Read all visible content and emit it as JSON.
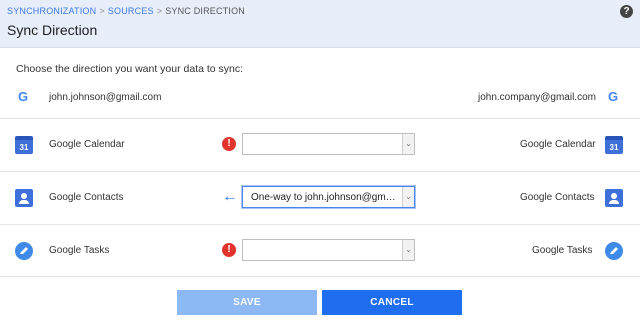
{
  "breadcrumb": {
    "items": [
      "SYNCHRONIZATION",
      "SOURCES"
    ],
    "separator": ">",
    "current": "SYNC DIRECTION"
  },
  "page_title": "Sync Direction",
  "help_icon": "?",
  "instruction": "Choose the direction you want your data to sync:",
  "accounts": {
    "left": "john.johnson@gmail.com",
    "right": "john.company@gmail.com",
    "logo_letter": "G"
  },
  "services": [
    {
      "name": "Google Calendar",
      "icon": "calendar-icon",
      "icon_text": "31",
      "indicator": "!",
      "indicator_type": "warning",
      "selected": ""
    },
    {
      "name": "Google Contacts",
      "icon": "contacts-icon",
      "icon_text": "",
      "indicator": "←",
      "indicator_type": "direction",
      "selected": "One-way to john.johnson@gmail.com"
    },
    {
      "name": "Google Tasks",
      "icon": "tasks-icon",
      "icon_text": "",
      "indicator": "!",
      "indicator_type": "warning",
      "selected": ""
    }
  ],
  "caret": "⌄",
  "buttons": {
    "save": "SAVE",
    "cancel": "CANCEL"
  },
  "colors": {
    "header_bg": "#e8eef9",
    "link": "#3b78e7",
    "warning": "#e0342c",
    "save_disabled": "#8cb8f3",
    "cancel": "#1f6ef0"
  }
}
